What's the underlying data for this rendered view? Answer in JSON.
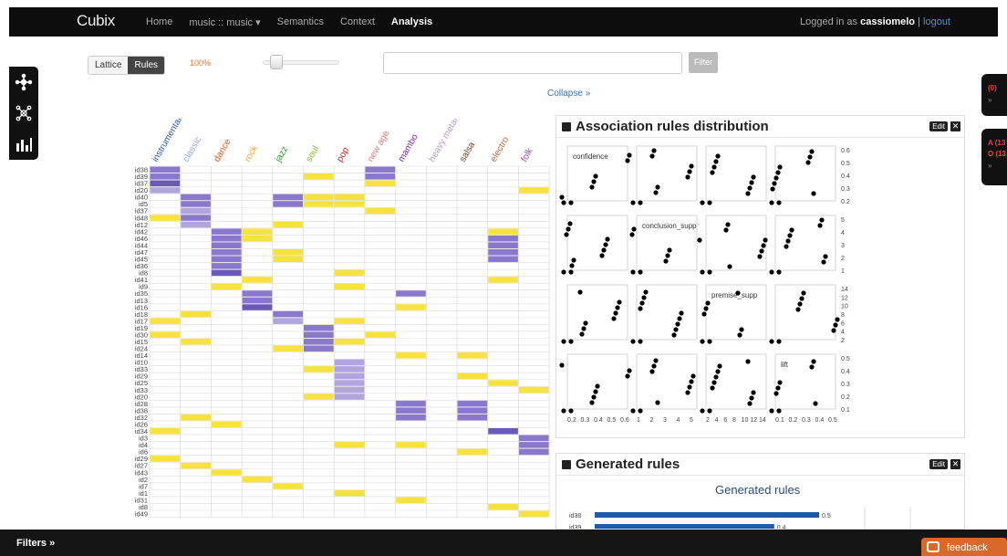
{
  "app": {
    "brand": "Cubix"
  },
  "nav": {
    "items": [
      {
        "label": "Home",
        "active": false
      },
      {
        "label": "music :: music ▾",
        "active": false
      },
      {
        "label": "Semantics",
        "active": false
      },
      {
        "label": "Context",
        "active": false
      },
      {
        "label": "Analysis",
        "active": true
      }
    ],
    "login_prefix": "Logged in as ",
    "username": "cassiomelo",
    "separator": " | ",
    "logout": "logout"
  },
  "toolbar": {
    "lattice_label": "Lattice",
    "rules_label": "Rules",
    "support_pct": "100%",
    "slider_value": 0.05,
    "filter_button": "Filter",
    "search_value": ""
  },
  "collapse_link": "Collapse »",
  "left_tools": [
    {
      "icon": "lattice-icon",
      "glyph": "✢"
    },
    {
      "icon": "network-icon",
      "glyph": "⁘"
    },
    {
      "icon": "bar-chart-icon",
      "glyph": "▮"
    }
  ],
  "right_tabs": {
    "tab1": {
      "red": "(0)",
      "gray": "»"
    },
    "tab2": {
      "red1": "A (13",
      "red2": "O (13",
      "gray": "»"
    }
  },
  "matrix": {
    "genres": [
      {
        "name": "instrumental",
        "color": "#2a55b3"
      },
      {
        "name": "classic",
        "color": "#8fa8e0"
      },
      {
        "name": "dance",
        "color": "#e05522"
      },
      {
        "name": "rock",
        "color": "#f2a33a"
      },
      {
        "name": "jazz",
        "color": "#2a9a2a"
      },
      {
        "name": "soul",
        "color": "#8ab42a"
      },
      {
        "name": "pop",
        "color": "#cc2222"
      },
      {
        "name": "new age",
        "color": "#e87878"
      },
      {
        "name": "mambo",
        "color": "#7a2aa0"
      },
      {
        "name": "heavy metal",
        "color": "#b89ad0"
      },
      {
        "name": "salsa",
        "color": "#6a4028"
      },
      {
        "name": "electro",
        "color": "#b86a3a"
      },
      {
        "name": "folk",
        "color": "#9a4ab8"
      }
    ],
    "rows": [
      "id38",
      "id39",
      "id37",
      "id20",
      "id40",
      "id5",
      "id37",
      "id48",
      "id12",
      "id42",
      "id46",
      "id44",
      "id47",
      "id45",
      "id36",
      "id8",
      "id41",
      "id9",
      "id35",
      "id13",
      "id16",
      "id18",
      "id17",
      "id19",
      "id30",
      "id15",
      "id24",
      "id14",
      "id10",
      "id33",
      "id29",
      "id25",
      "id33",
      "id20",
      "id28",
      "id38",
      "id32",
      "id26",
      "id34",
      "id3",
      "id4",
      "id6",
      "id29",
      "id27",
      "id43",
      "id2",
      "id7",
      "id1",
      "id31",
      "id8",
      "id49"
    ]
  },
  "association_panel": {
    "title": "Association rules distribution",
    "edit_label": "Edit",
    "close_glyph": "✕",
    "vars": [
      "confidence",
      "conclusion_supp",
      "premise_supp",
      "lift"
    ],
    "diag_labels": [
      "confidence",
      "conclusion_supp",
      "premise_supp",
      "lift"
    ],
    "right_ticks": [
      [
        "0.6",
        "0.5",
        "0.4",
        "0.3",
        "0.2"
      ],
      [
        "5",
        "4",
        "3",
        "2",
        "1"
      ],
      [
        "14",
        "12",
        "10",
        "8",
        "6",
        "4",
        "2"
      ],
      [
        "0.5",
        "0.4",
        "0.3",
        "0.2",
        "0.1"
      ]
    ],
    "bottom_ticks": [
      [
        "0.2",
        "0.3",
        "0.4",
        "0.5",
        "0.6"
      ],
      [
        "1",
        "2",
        "3",
        "4",
        "5"
      ],
      [
        "2",
        "4",
        "6",
        "8",
        "10",
        "12",
        "14"
      ],
      [
        "0.1",
        "0.2",
        "0.3",
        "0.4",
        "0.5"
      ]
    ]
  },
  "generated_panel": {
    "title": "Generated rules",
    "edit_label": "Edit",
    "close_glyph": "✕",
    "chart_title": "Generated rules",
    "bars": [
      {
        "label": "id38",
        "value": 0.5
      },
      {
        "label": "id39",
        "value": 0.4
      }
    ]
  },
  "bottom": {
    "filters_label": "Filters »",
    "feedback_label": "feedback"
  },
  "colors": {
    "purple": "#8a78cc",
    "yellow": "#f7e23e",
    "accent": "#2a72c5"
  }
}
